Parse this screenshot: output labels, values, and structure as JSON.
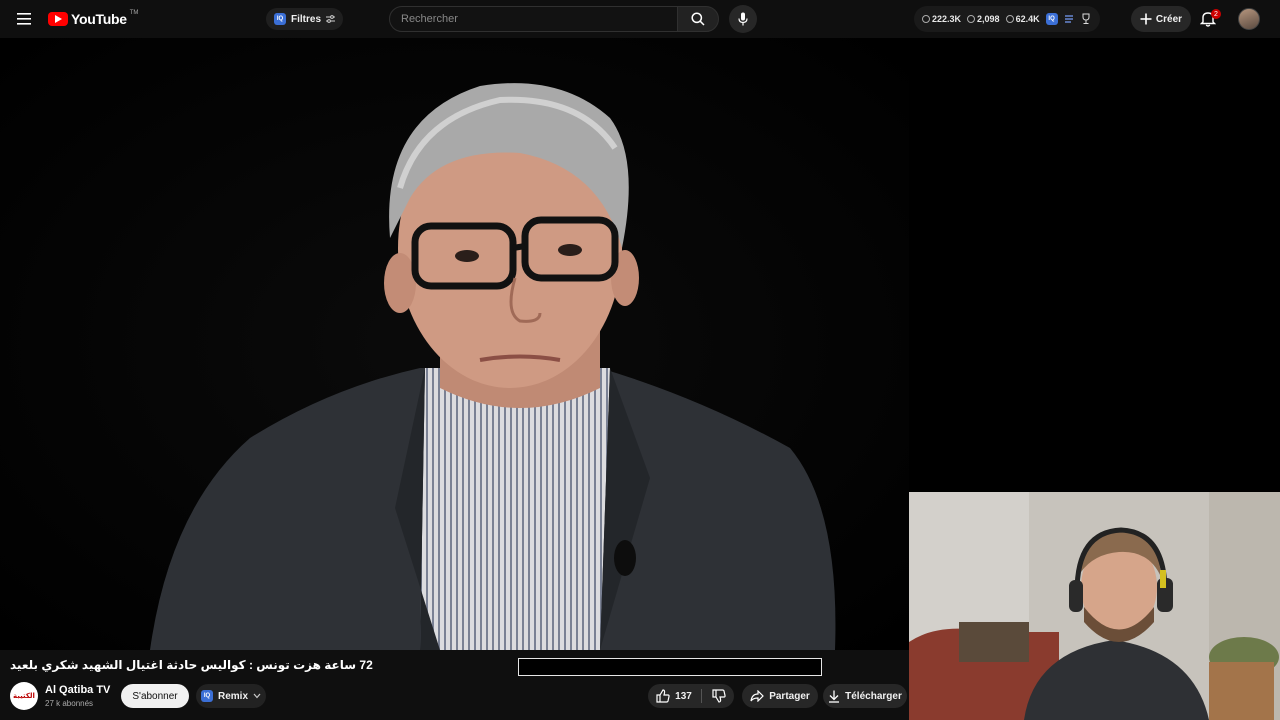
{
  "app": {
    "brand": "YouTube",
    "brand_suffix": "TM"
  },
  "header": {
    "menu_icon": "hamburger-icon",
    "filters_badge": "IQ",
    "filters_label": "Filtres",
    "search": {
      "placeholder": "Rechercher",
      "value": ""
    },
    "stats": {
      "watch_time": "222.3K",
      "views": "2,098",
      "subs": "62.4K",
      "badge": "IQ"
    },
    "create_label": "Créer",
    "notification_count": "2"
  },
  "video": {
    "title": "72 ساعة هزت تونس : كواليس حادثة اغتيال الشهيد شكري بلعيد"
  },
  "channel": {
    "name": "Al Qatiba TV",
    "subscribers": "27 k abonnés",
    "avatar_text": "الكتيبة",
    "subscribe_label": "S'abonner",
    "remix_badge": "IQ",
    "remix_label": "Remix"
  },
  "actions": {
    "likes": "137",
    "share_label": "Partager",
    "download_label": "Télécharger"
  },
  "colors": {
    "brand_red": "#ff0000",
    "background": "#0f0f0f",
    "accent_blue": "#3b6fd6"
  }
}
